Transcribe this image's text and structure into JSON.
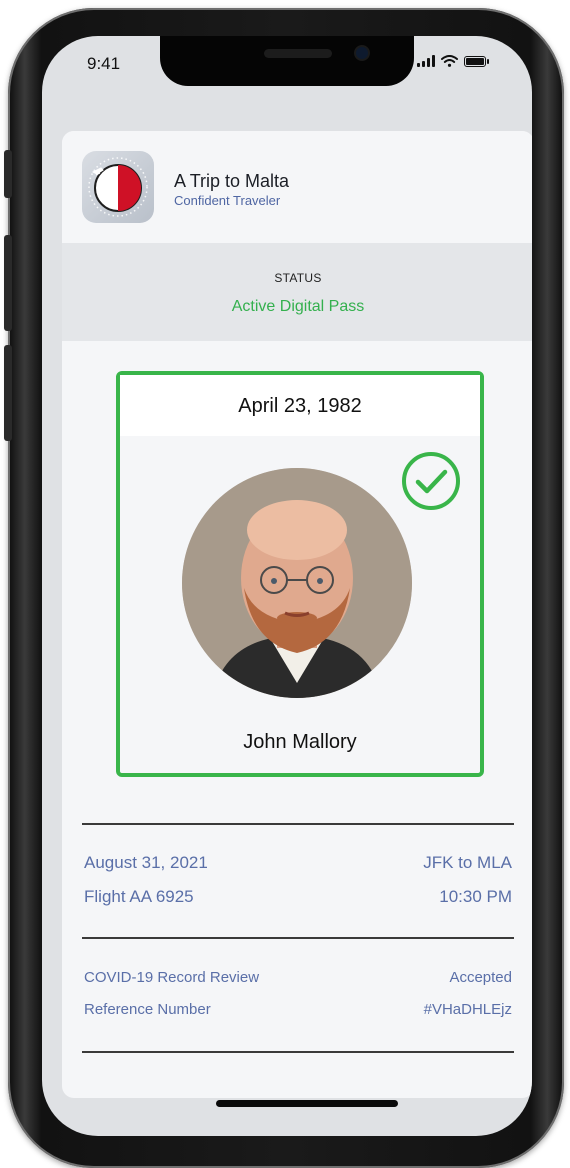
{
  "status_bar": {
    "time": "9:41"
  },
  "header": {
    "app_title": "A Trip to Malta",
    "app_subtitle": "Confident Traveler"
  },
  "status": {
    "label": "STATUS",
    "value": "Active Digital Pass"
  },
  "pass": {
    "date_of_birth": "April 23, 1982",
    "name": "John Mallory",
    "verified": true
  },
  "flight": {
    "date": "August 31, 2021",
    "route": "JFK to MLA",
    "flight_number": "Flight AA 6925",
    "time": "10:30 PM"
  },
  "record": {
    "review_label": "COVID-19 Record Review",
    "review_value": "Accepted",
    "reference_label": "Reference Number",
    "reference_value": "#VHaDHLEjz"
  },
  "colors": {
    "accent_green": "#39b54a",
    "link_blue": "#4f66a3",
    "flag_red": "#cf1126"
  }
}
